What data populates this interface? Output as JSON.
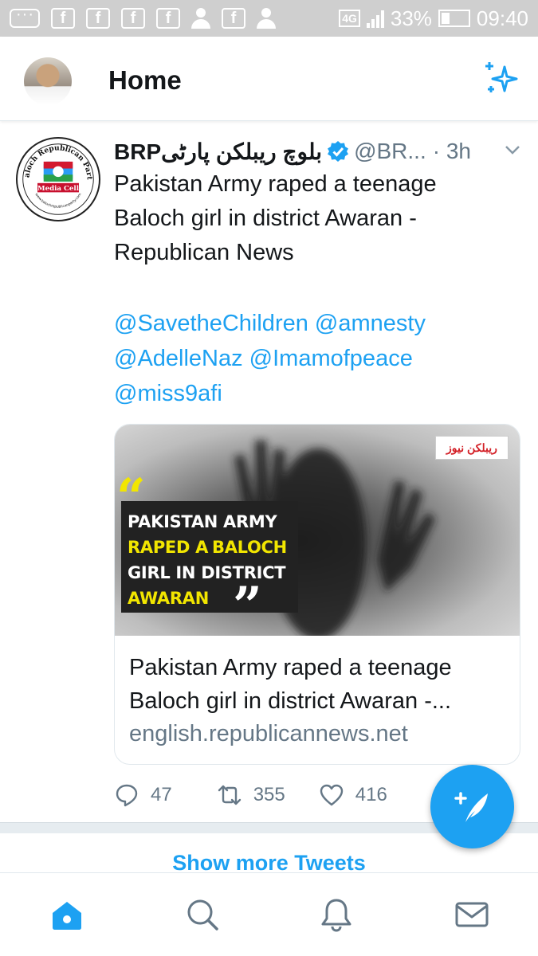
{
  "status_bar": {
    "time": "09:40",
    "battery": "33%",
    "network": "4G"
  },
  "header": {
    "title": "Home",
    "accent": "#1da1f2"
  },
  "tweet": {
    "name": "BRPبلوچ ریبلکن پارٹی",
    "handle": "@BR...",
    "time": "· 3h",
    "text_lines": [
      "Pakistan Army raped a teenage",
      "Baloch girl in district Awaran -",
      "Republican News"
    ],
    "mentions_lines": [
      "@SavetheChildren @amnesty",
      "@AdelleNaz @Imamofpeace",
      "@miss9afi"
    ],
    "avatar_text": {
      "top": "Baloch Republican Party",
      "middle": "Media Cell",
      "bottom": "www.balochrepublicanparty.com"
    },
    "card": {
      "image_lines": [
        "PAKISTAN ARMY",
        "RAPED A",
        "BALOCH",
        "GIRL IN DISTRICT",
        "AWARAN"
      ],
      "logo_text": "ریبلکن نیوز",
      "title_lines": [
        "Pakistan Army raped a teenage",
        "Baloch girl in district Awaran -..."
      ],
      "domain": "english.republicannews.net"
    },
    "stats": {
      "replies": "47",
      "retweets": "355",
      "likes": "416"
    }
  },
  "show_more": "Show more Tweets",
  "icons": {
    "sparkle": "sparkle-icon",
    "verified": "verified-badge-icon",
    "caret": "chevron-down-icon",
    "reply": "reply-icon",
    "retweet": "retweet-icon",
    "like": "heart-icon",
    "compose": "compose-tweet-icon",
    "home": "home-icon",
    "search": "search-icon",
    "notifications": "bell-icon",
    "messages": "mail-icon"
  }
}
